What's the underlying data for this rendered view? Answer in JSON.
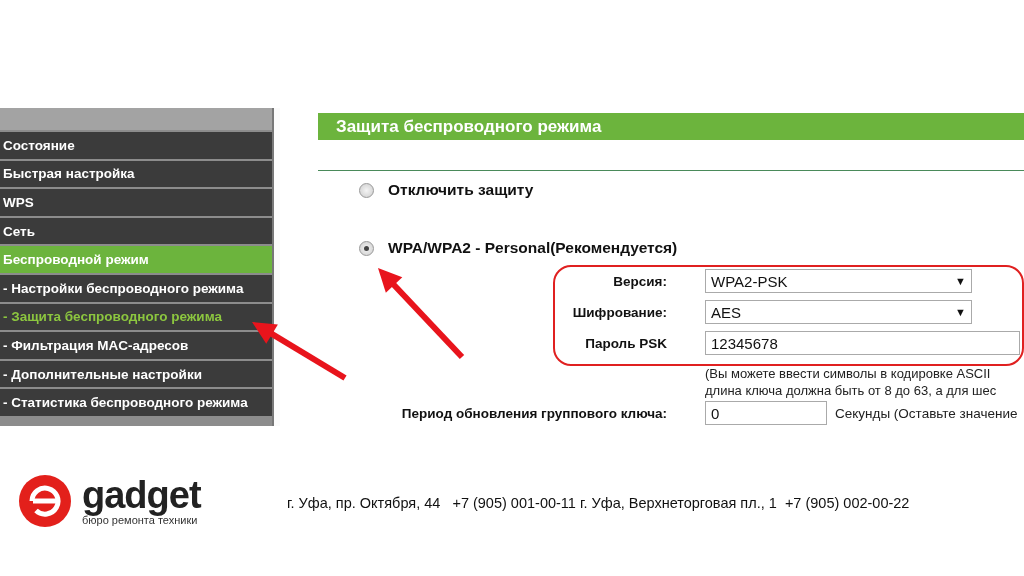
{
  "menu": [
    {
      "label": "Состояние",
      "kind": "main",
      "selected": false
    },
    {
      "label": "Быстрая настройка",
      "kind": "main",
      "selected": false
    },
    {
      "label": "WPS",
      "kind": "main",
      "selected": false
    },
    {
      "label": "Сеть",
      "kind": "main",
      "selected": false
    },
    {
      "label": "Беспроводной режим",
      "kind": "main",
      "selected": true
    },
    {
      "label": "- Настройки беспроводного режима",
      "kind": "sub",
      "selected": false
    },
    {
      "label": "- Защита беспроводного режима",
      "kind": "sub",
      "selected": true
    },
    {
      "label": "- Фильтрация MAC-адресов",
      "kind": "sub",
      "selected": false
    },
    {
      "label": "- Дополнительные настройки",
      "kind": "sub",
      "selected": false
    },
    {
      "label": "- Статистика беспроводного режима",
      "kind": "sub",
      "selected": false
    }
  ],
  "section_title": "Защита беспроводного режима",
  "options": [
    {
      "label": "Отключить защиту",
      "selected": false
    },
    {
      "label": "WPA/WPA2 - Personal(Рекомендуется)",
      "selected": true
    }
  ],
  "fields": [
    {
      "label": "Версия:",
      "kind": "select",
      "value": "WPA2-PSK",
      "arrow": "▼"
    },
    {
      "label": "Шифрование:",
      "kind": "select",
      "value": "AES",
      "arrow": "▼"
    },
    {
      "label": "Пароль PSK",
      "kind": "input",
      "value": "12345678"
    }
  ],
  "hint": [
    "(Вы можете ввести символы в кодировке ASCII",
    "длина ключа должна быть от 8 до 63, а для шес"
  ],
  "group_key": {
    "label": "Период обновления группового ключа:",
    "value": "0",
    "note": "Секунды (Оставьте значение"
  },
  "footer": {
    "brand": "gadget",
    "tagline": "бюро ремонта техники",
    "contacts": "г. Уфа, пр. Октября, 44   +7 (905) 001-00-11 г. Уфа, Верхнеторговая пл., 1  +7 (905) 002-00-22"
  }
}
